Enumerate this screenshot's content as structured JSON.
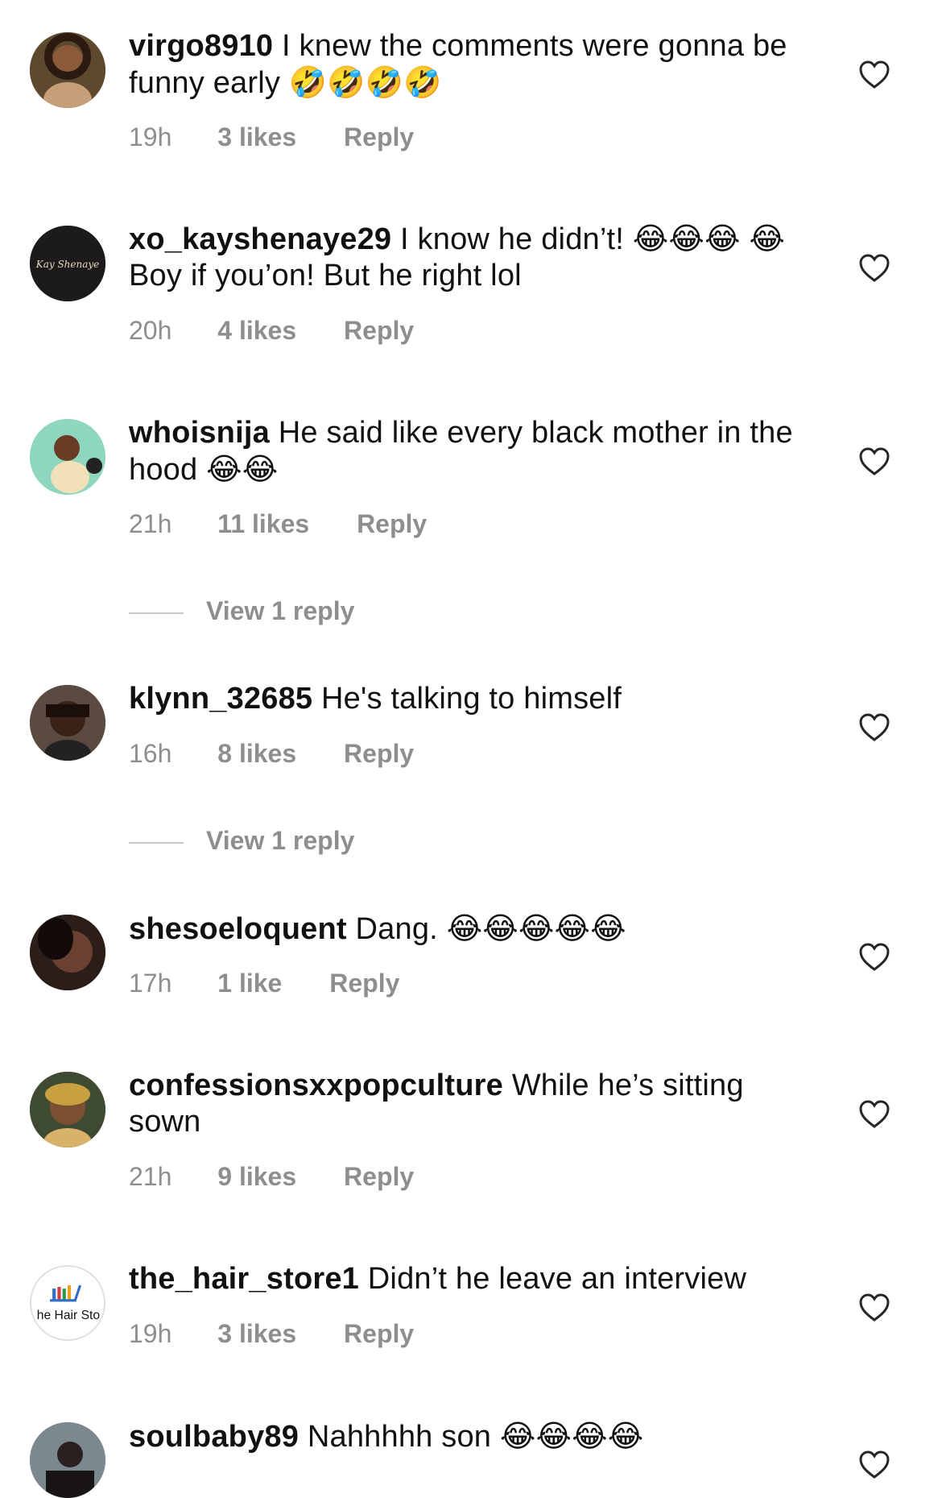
{
  "comments": [
    {
      "username": "virgo8910",
      "text": "I knew the comments were gonna be funny early",
      "emoji": "🤣🤣🤣🤣",
      "time": "19h",
      "likes": "3 likes",
      "reply": "Reply",
      "avatar_color": "#7a5a3c"
    },
    {
      "username": "xo_kayshenaye29",
      "text": "I know he didn’t! 😂😂😂 😂 Boy if you’on! But he right lol",
      "emoji": "",
      "time": "20h",
      "likes": "4 likes",
      "reply": "Reply",
      "avatar_color": "#1c1a1a",
      "avatar_text": "Kay Shenaye"
    },
    {
      "username": "whoisnija",
      "text": "He said like every black mother in the hood",
      "emoji": "😂😂",
      "time": "21h",
      "likes": "11 likes",
      "reply": "Reply",
      "avatar_color": "#8fd6c1",
      "view_replies": "View 1 reply"
    },
    {
      "username": "klynn_32685",
      "text": "He's talking to himself",
      "emoji": "",
      "time": "16h",
      "likes": "8 likes",
      "reply": "Reply",
      "avatar_color": "#3a2a22",
      "view_replies": "View 1 reply"
    },
    {
      "username": "shesoeloquent",
      "text": "Dang.",
      "emoji": "😂😂😂😂😂",
      "time": "17h",
      "likes": "1 like",
      "reply": "Reply",
      "avatar_color": "#2b1d18"
    },
    {
      "username": "confessionsxxpopculture",
      "text": "While he’s sitting sown",
      "emoji": "",
      "time": "21h",
      "likes": "9 likes",
      "reply": "Reply",
      "avatar_color": "#4b5a3a"
    },
    {
      "username": "the_hair_store1",
      "text": "Didn’t he leave an interview",
      "emoji": "",
      "time": "19h",
      "likes": "3 likes",
      "reply": "Reply",
      "avatar_color": "#ffffff",
      "avatar_text": "he Hair Sto"
    },
    {
      "username": "soulbaby89",
      "text": "Nahhhhh son",
      "emoji": "😂😂😂😂",
      "avatar_color": "#6f7a80"
    }
  ],
  "colors": {
    "text": "#111111",
    "secondary": "#8e8e8e",
    "divider": "#c7c7c7"
  },
  "icons": {
    "like": "heart-outline-icon"
  }
}
